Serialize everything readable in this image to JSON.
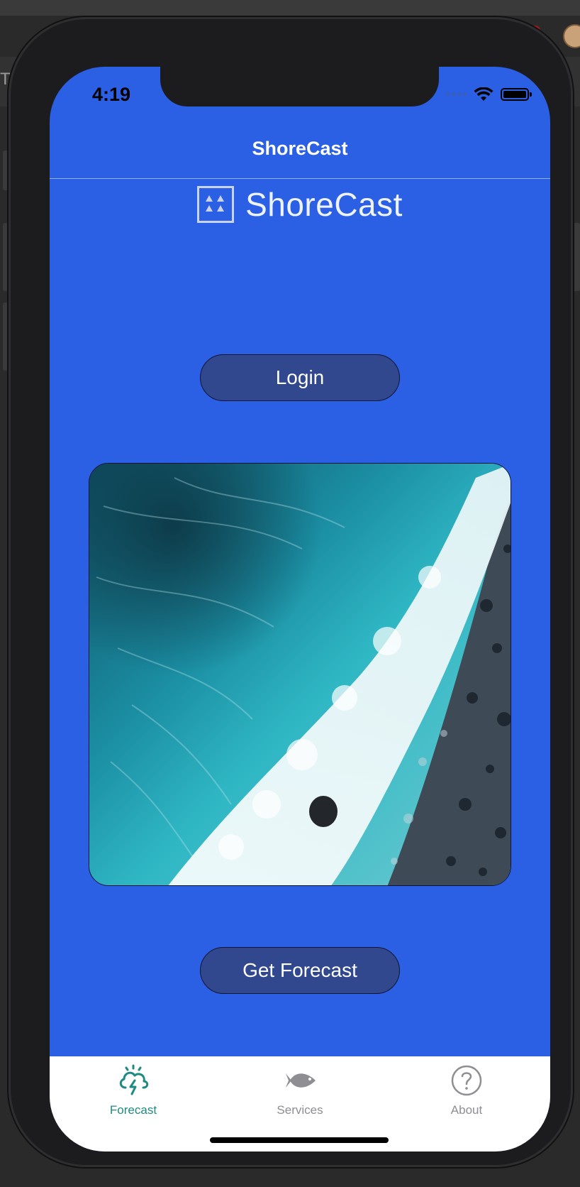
{
  "status": {
    "time": "4:19"
  },
  "nav": {
    "title": "ShoreCast"
  },
  "brand": {
    "name": "ShoreCast",
    "logo_icon": "triangles-logo-icon"
  },
  "buttons": {
    "login_label": "Login",
    "forecast_label": "Get Forecast"
  },
  "hero_image": {
    "subject": "aerial-ocean-waves-image"
  },
  "tabs": [
    {
      "label": "Forecast",
      "icon": "cloud-lightning-icon",
      "active": true
    },
    {
      "label": "Services",
      "icon": "fish-icon",
      "active": false
    },
    {
      "label": "About",
      "icon": "question-circle-icon",
      "active": false
    }
  ],
  "colors": {
    "screen_background": "#2c60e4",
    "button_fill": "#31478e",
    "tab_active": "#1f8a83",
    "tab_inactive": "#8e8e93"
  }
}
